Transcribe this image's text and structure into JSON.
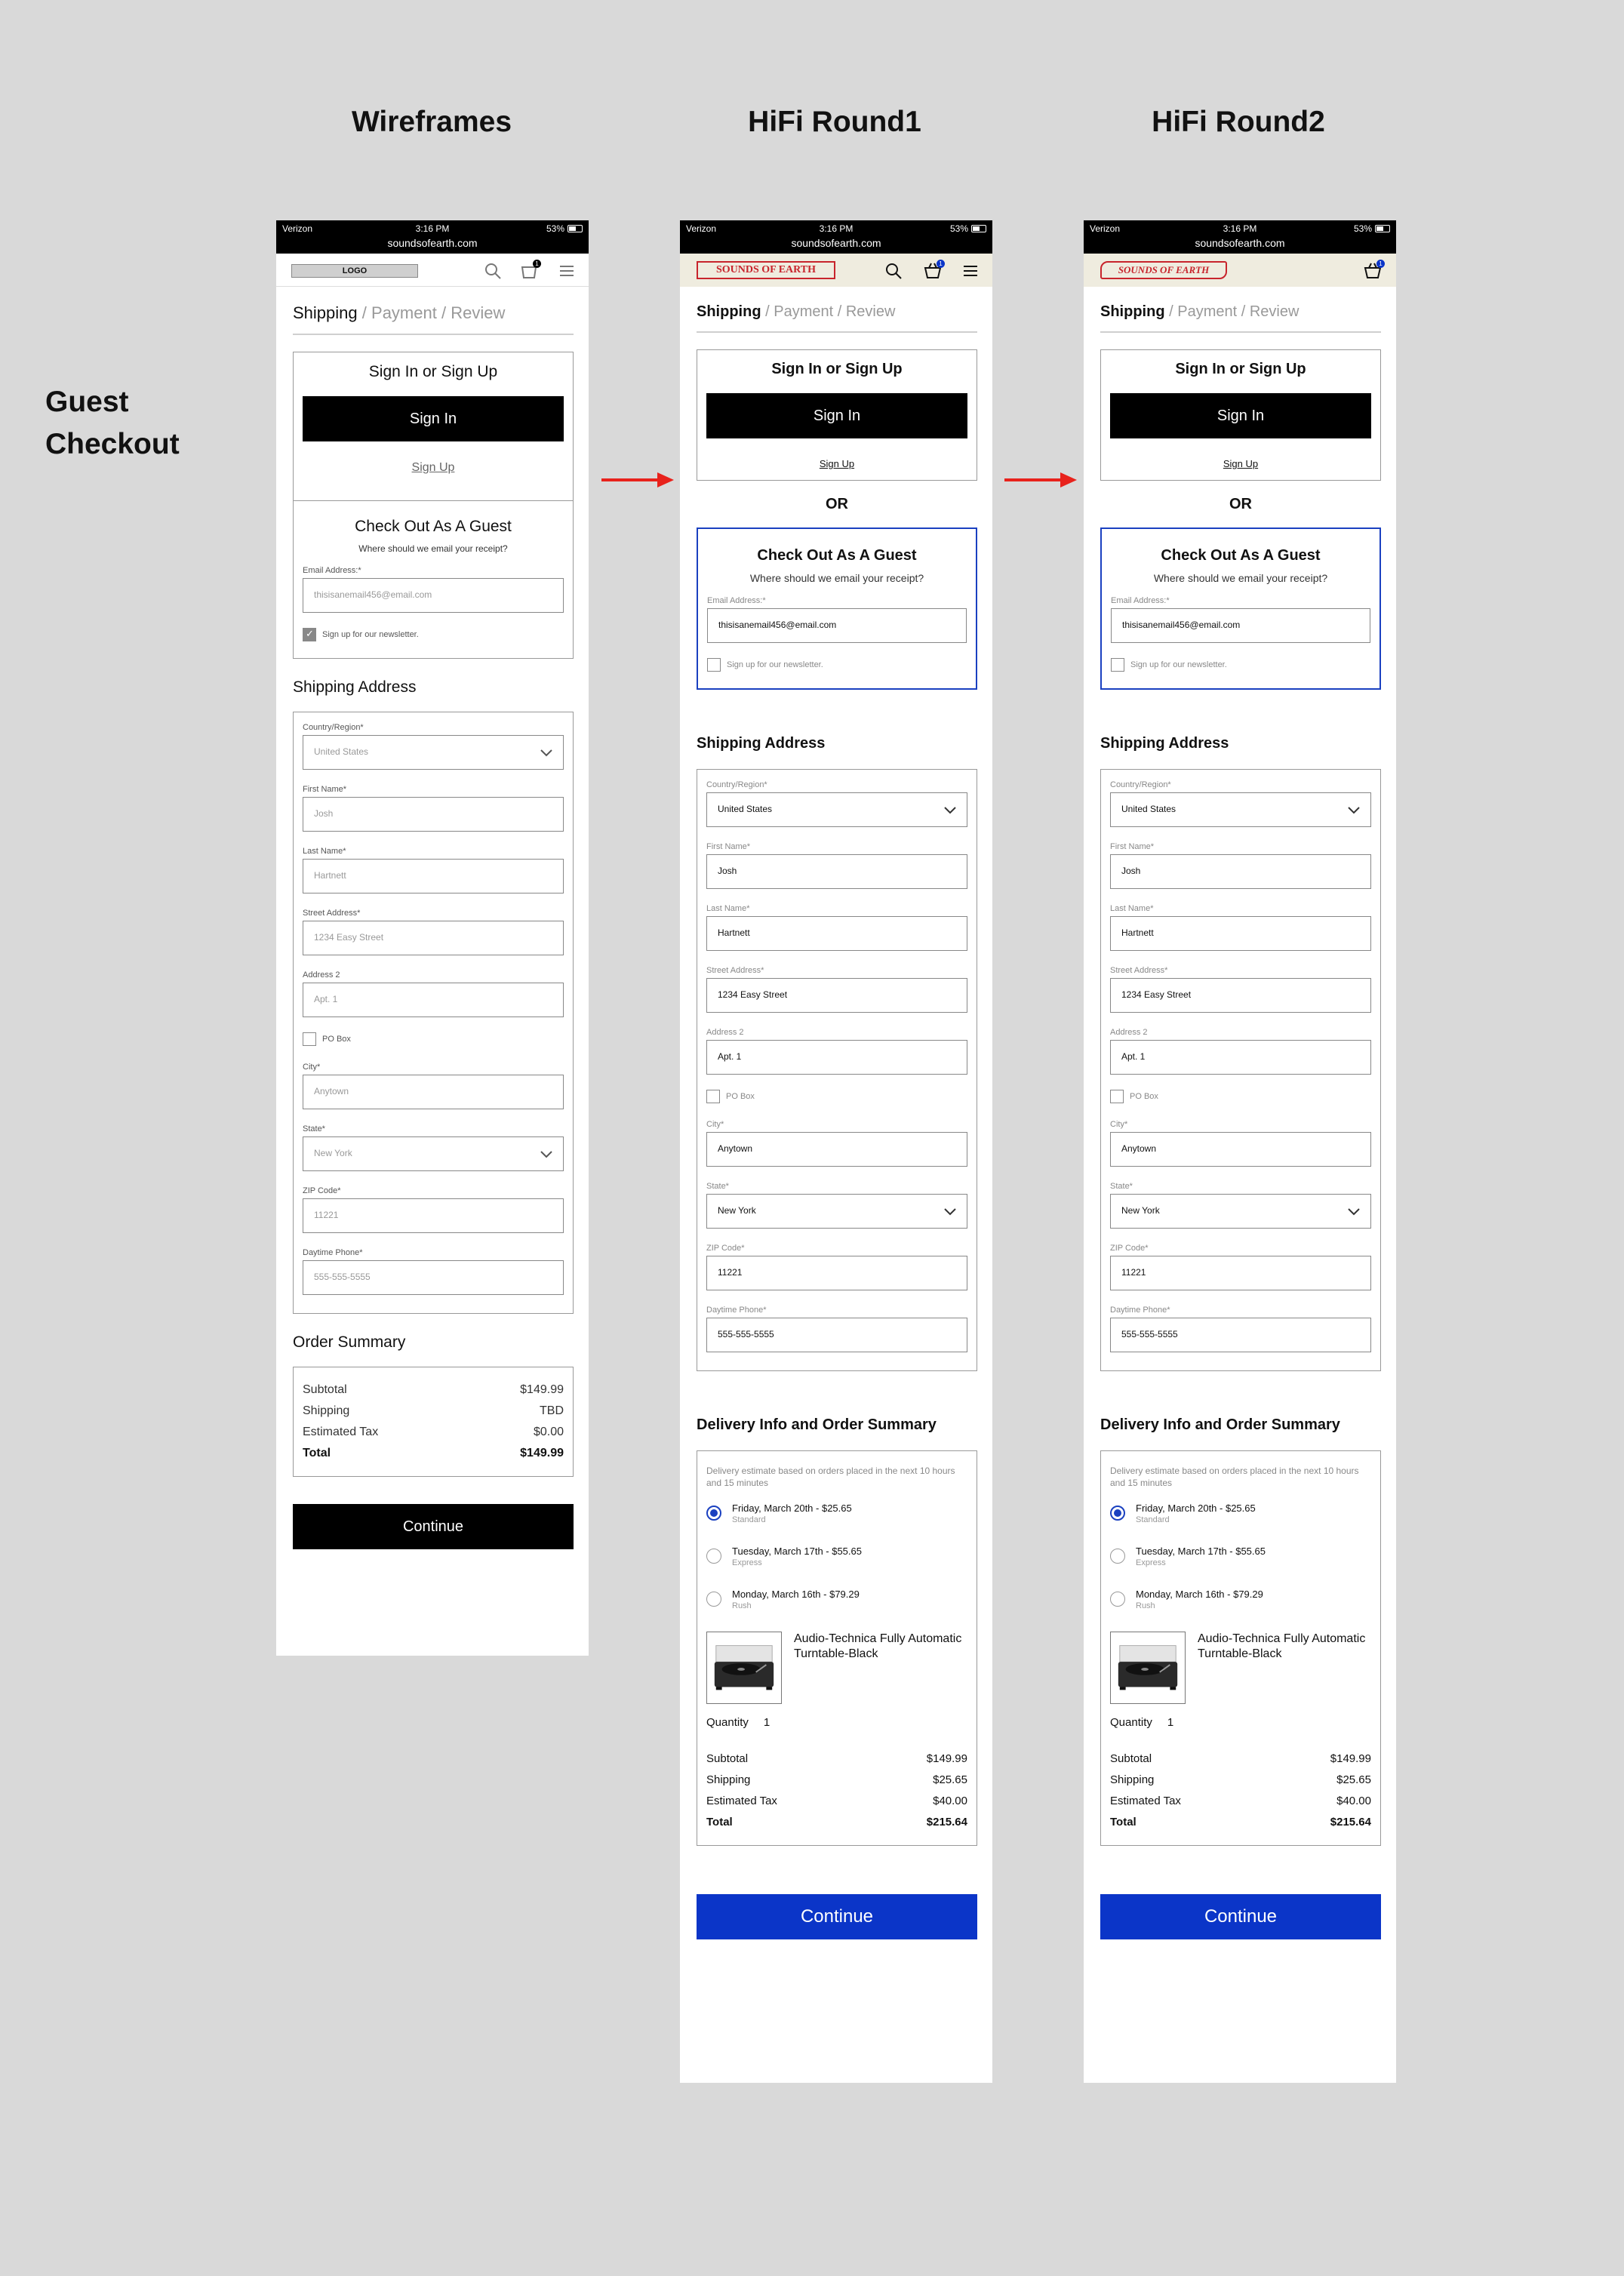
{
  "headings": {
    "wireframes": "Wireframes",
    "round1": "HiFi Round1",
    "round2": "HiFi Round2",
    "section": "Guest Checkout"
  },
  "colors": {
    "accent_blue": "#0b35c8",
    "brand_red": "#c8242c",
    "arrow_red": "#e8221c",
    "nav_cream": "#efecdf"
  },
  "status_bar": {
    "carrier": "Verizon",
    "time": "3:16 PM",
    "battery": "53%",
    "url": "soundsofearth.com"
  },
  "nav": {
    "logo_wf": "LOGO",
    "logo_brand": "SOUNDS OF EARTH",
    "logo_brand_r2": "SOUNDS OF EARTH",
    "cart_count": "1"
  },
  "steps": {
    "shipping": "Shipping",
    "payment": "Payment",
    "review": "Review",
    "sep": "/"
  },
  "signin": {
    "title": "Sign In or Sign Up",
    "button": "Sign In",
    "link": "Sign Up",
    "or": "OR"
  },
  "guest": {
    "title": "Check Out As A Guest",
    "subtitle": "Where should we email your receipt?",
    "email_label": "Email Address:*",
    "email_placeholder": "thisisanemail456@email.com",
    "email_value": "thisisanemail456@email.com",
    "newsletter": "Sign up for our newsletter."
  },
  "shipping": {
    "title": "Shipping Address",
    "country_label": "Country/Region*",
    "country": "United States",
    "first_label": "First Name*",
    "first": "Josh",
    "last_label": "Last Name*",
    "last": "Hartnett",
    "street_label": "Street Address*",
    "street": "1234 Easy Street",
    "addr2_label": "Address 2",
    "addr2": "Apt. 1",
    "pobox": "PO Box",
    "city_label": "City*",
    "city": "Anytown",
    "state_label": "State*",
    "state": "New York",
    "zip_label": "ZIP Code*",
    "zip": "11221",
    "phone_label": "Daytime Phone*",
    "phone_wf": "555-555-5555",
    "phone": "555-555-5555"
  },
  "order_wf": {
    "title": "Order Summary",
    "subtotal_label": "Subtotal",
    "subtotal": "$149.99",
    "shipping_label": "Shipping",
    "shipping": "TBD",
    "tax_label": "Estimated Tax",
    "tax": "$0.00",
    "total_label": "Total",
    "total": "$149.99",
    "continue": "Continue"
  },
  "delivery": {
    "title": "Delivery Info and Order Summary",
    "note": "Delivery estimate based on orders placed in the next 10 hours and 15 minutes",
    "options": [
      {
        "label": "Friday, March 20th - $25.65",
        "sub": "Standard",
        "selected": true
      },
      {
        "label": "Tuesday, March 17th - $55.65",
        "sub": "Express",
        "selected": false
      },
      {
        "label": "Monday, March 16th - $79.29",
        "sub": "Rush",
        "selected": false
      }
    ],
    "product": "Audio-Technica Fully Automatic Turntable-Black",
    "quantity_label": "Quantity",
    "quantity": "1",
    "subtotal_label": "Subtotal",
    "subtotal": "$149.99",
    "shipping_label": "Shipping",
    "shipping": "$25.65",
    "tax_label": "Estimated Tax",
    "tax": "$40.00",
    "total_label": "Total",
    "total": "$215.64",
    "continue": "Continue"
  }
}
